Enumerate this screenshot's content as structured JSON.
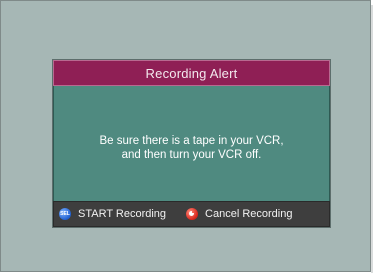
{
  "dialog": {
    "title": "Recording Alert",
    "message_line1": "Be sure there is a tape in your VCR,",
    "message_line2": "and then turn your VCR off."
  },
  "footer": {
    "start_label": "START Recording",
    "start_icon": "sel-button-icon",
    "start_icon_text": "SEL",
    "cancel_label": "Cancel Recording",
    "cancel_icon": "cancel-button-icon"
  },
  "colors": {
    "background": "#a6b7b5",
    "title_bar": "#8f1f55",
    "body": "#4f8a80",
    "footer": "#3e3e3e",
    "sel_icon": "#1f5fd0",
    "cancel_icon": "#d8231a"
  }
}
